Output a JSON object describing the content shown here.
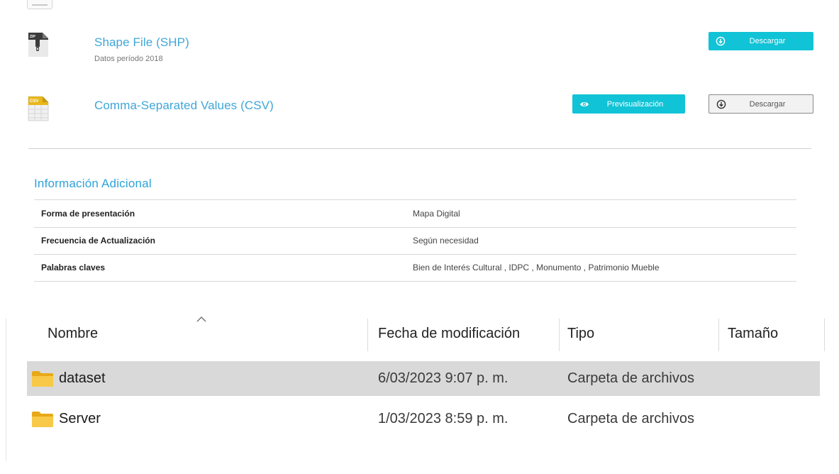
{
  "resources": [
    {
      "title": "Shape File (SHP)",
      "subtitle": "Datos período 2018",
      "icon": "zip-file-icon",
      "buttons": [
        {
          "label": "Descargar",
          "style": "teal",
          "icon": "download-icon"
        }
      ]
    },
    {
      "title": "Comma-Separated Values (CSV)",
      "subtitle": "",
      "icon": "csv-file-icon",
      "buttons": [
        {
          "label": "Previsualización",
          "style": "teal",
          "icon": "eye-icon"
        },
        {
          "label": "Descargar",
          "style": "gray",
          "icon": "download-icon"
        }
      ]
    }
  ],
  "info": {
    "title": "Información Adicional",
    "rows": [
      {
        "key": "Forma de presentación",
        "value": "Mapa Digital"
      },
      {
        "key": "Frecuencia de Actualización",
        "value": "Según necesidad"
      },
      {
        "key": "Palabras claves",
        "value": "Bien de Interés Cultural , IDPC , Monumento , Patrimonio Mueble"
      }
    ]
  },
  "explorer": {
    "columns": [
      "Nombre",
      "Fecha de modificación",
      "Tipo",
      "Tamaño"
    ],
    "sort_indicator": "chevron-up-icon",
    "rows": [
      {
        "name": "dataset",
        "date": "6/03/2023 9:07 p. m.",
        "type": "Carpeta de archivos",
        "size": "",
        "selected": true,
        "icon": "folder-icon"
      },
      {
        "name": "Server",
        "date": "1/03/2023 8:59 p. m.",
        "type": "Carpeta de archivos",
        "size": "",
        "selected": false,
        "icon": "folder-icon"
      }
    ]
  },
  "colors": {
    "accent_blue": "#3fa6d8",
    "button_teal": "#11c3d6",
    "folder_yellow": "#f6c443",
    "selected_row": "#d9d9d9"
  }
}
